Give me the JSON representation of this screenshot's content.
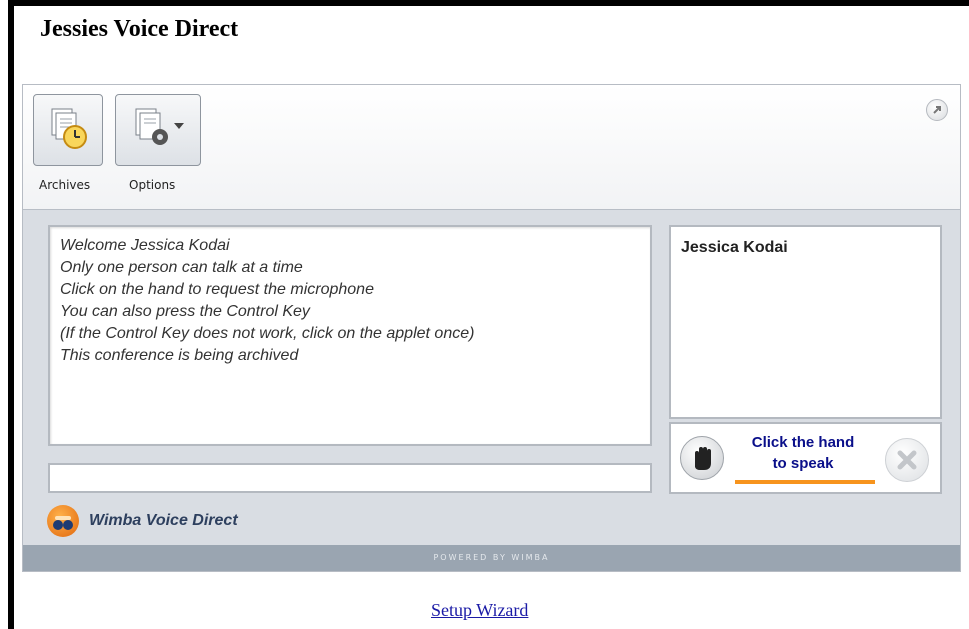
{
  "page": {
    "title": "Jessies Voice Direct"
  },
  "toolbar": {
    "archives_label": "Archives",
    "options_label": "Options",
    "archives_icon": "archives-clock-icon",
    "options_icon": "options-gear-icon",
    "popout_icon": "popout-arrow-icon"
  },
  "messages": [
    "Welcome Jessica Kodai",
    "Only one person can talk at a time",
    "Click on the hand to request the microphone",
    "You can also press the Control Key",
    "(If the Control Key does not work, click on the applet once)",
    "This conference is being archived"
  ],
  "chat_input": {
    "value": ""
  },
  "participants": [
    "Jessica Kodai"
  ],
  "talk": {
    "line1": "Click the hand",
    "line2": "to speak",
    "hand_icon": "hand-icon",
    "cancel_icon": "cancel-x-icon"
  },
  "brand": {
    "name": "Wimba Voice Direct"
  },
  "footer": {
    "powered": "POWERED BY WIMBA"
  },
  "links": {
    "setup_wizard": "Setup Wizard"
  },
  "colors": {
    "accent_orange": "#f7941d",
    "link_blue": "#1a1aa6",
    "click_text_blue": "#0a0f8a"
  }
}
